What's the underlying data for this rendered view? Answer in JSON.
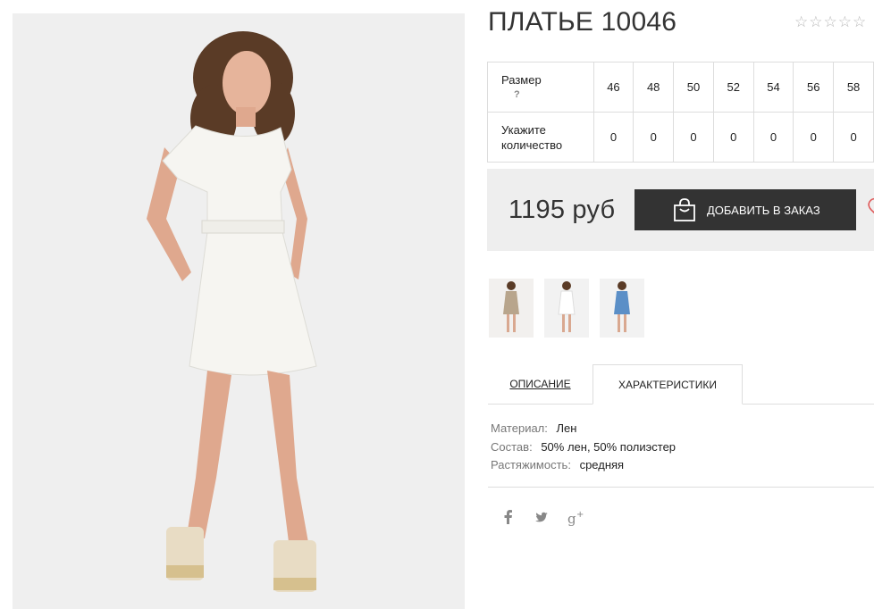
{
  "product": {
    "title": "ПЛАТЬЕ 10046",
    "rating_stars": "☆☆☆☆☆",
    "image_alt": "photo-main"
  },
  "sizes": {
    "size_label": "Размер",
    "help_mark": "?",
    "qty_label_1": "Укажите",
    "qty_label_2": "количество",
    "values": [
      "46",
      "48",
      "50",
      "52",
      "54",
      "56",
      "58"
    ],
    "quantities": [
      "0",
      "0",
      "0",
      "0",
      "0",
      "0",
      "0"
    ]
  },
  "purchase": {
    "price": "1195 руб",
    "add_button_label": "ДОБАВИТЬ В ЗАКАЗ"
  },
  "thumbnails": [
    {
      "name": "beige"
    },
    {
      "name": "white"
    },
    {
      "name": "blue"
    }
  ],
  "tabs": {
    "description": "ОПИСАНИЕ",
    "characteristics": "ХАРАКТЕРИСТИКИ"
  },
  "specs": [
    {
      "key": "Материал:",
      "value": "Лен"
    },
    {
      "key": "Состав:",
      "value": "50% лен, 50% полиэстер"
    },
    {
      "key": "Растяжимость:",
      "value": "средняя"
    }
  ],
  "colors": {
    "button_bg": "#333333",
    "price_bar_bg": "#eeeeee",
    "heart": "#e05a5a",
    "dress_white": "#f4f3ef",
    "dress_beige": "#b8a58c",
    "dress_blue": "#5b8fc7"
  }
}
